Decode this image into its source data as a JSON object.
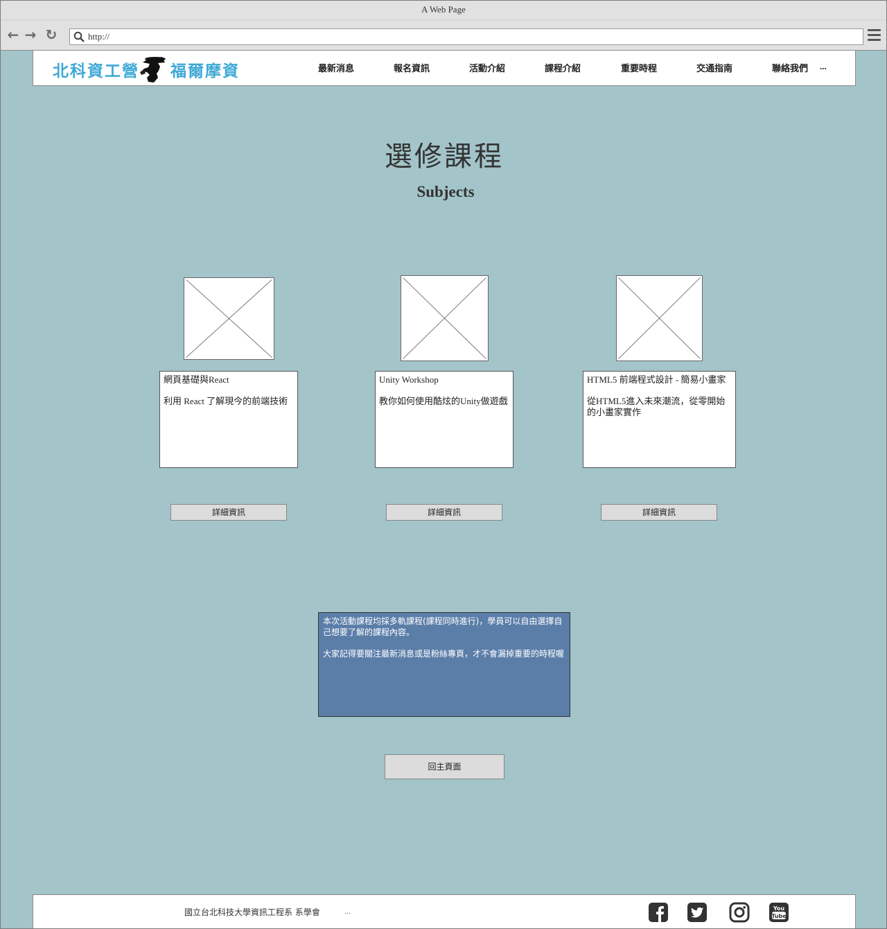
{
  "browser": {
    "title": "A Web Page",
    "url": "http://"
  },
  "header": {
    "logo_left": "北科資工營",
    "logo_right": "福爾摩資",
    "nav": [
      "最新消息",
      "報名資訊",
      "活動介紹",
      "課程介紹",
      "重要時程",
      "交通指南",
      "聯絡我們",
      "..."
    ]
  },
  "main": {
    "title": "選修課程",
    "subtitle": "Subjects",
    "courses": [
      {
        "title": "網頁基礎與React",
        "description": "利用 React 了解現今的前端技術",
        "button": "詳細資訊"
      },
      {
        "title": "Unity Workshop",
        "description": "教你如何使用酷炫的Unity做遊戲",
        "button": "詳細資訊"
      },
      {
        "title": "HTML5 前端程式設計 - 簡易小畫家",
        "description": "從HTML5進入未來潮流，從零開始的小畫家實作",
        "button": "詳細資訊"
      }
    ],
    "note": [
      "本次活動課程均採多軌課程(課程同時進行)，學員可以自由選擇自己想要了解的課程內容。",
      "大家記得要關注最新消息或是粉絲專頁，才不會漏掉重要的時程喔"
    ],
    "back_button": "回主頁面"
  },
  "footer": {
    "text": "國立台北科技大學資訊工程系 系學會",
    "more": "...",
    "social": [
      "facebook-icon",
      "twitter-icon",
      "instagram-icon",
      "youtube-icon"
    ]
  },
  "colors": {
    "page_bg": "#a3c4c9",
    "note_bg": "#5b7ea9",
    "logo_text": "#3fa9d6"
  }
}
